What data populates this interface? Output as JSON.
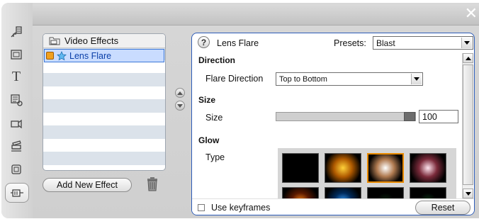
{
  "window": {
    "close_glyph": "✕"
  },
  "toolbar": {
    "items": [
      {
        "name": "project-tool-icon"
      },
      {
        "name": "album-tool-icon"
      },
      {
        "name": "title-tool-icon",
        "glyph": "T"
      },
      {
        "name": "menu-tool-icon"
      },
      {
        "name": "audio-tool-icon"
      },
      {
        "name": "video-capture-tool-icon"
      },
      {
        "name": "transitions-tool-icon"
      },
      {
        "name": "video-effects-tool-icon"
      }
    ]
  },
  "effects_list": {
    "header": "Video Effects",
    "items": [
      {
        "label": "Lens Flare",
        "selected": true
      }
    ],
    "add_button": "Add New Effect"
  },
  "panel": {
    "title": "Lens Flare",
    "presets_label": "Presets:",
    "preset_value": "Blast",
    "sections": {
      "direction": "Direction",
      "size": "Size",
      "glow": "Glow"
    },
    "flare_direction_label": "Flare Direction",
    "flare_direction_value": "Top to Bottom",
    "size_label": "Size",
    "size_value": "100",
    "size_level_percent": 100,
    "glow_type_label": "Type",
    "glow_types": [
      {
        "colors": [
          "#000000",
          "#000000"
        ],
        "selected": false
      },
      {
        "colors": [
          "#ffd23a",
          "#b05a00"
        ],
        "selected": false
      },
      {
        "colors": [
          "#ffffff",
          "#b07a50"
        ],
        "selected": true
      },
      {
        "colors": [
          "#ffe6f0",
          "#7a2a3a"
        ],
        "selected": false
      },
      {
        "colors": [
          "#ff8a1a",
          "#5a1a00"
        ],
        "selected": false
      },
      {
        "colors": [
          "#3aa0ff",
          "#002a5a"
        ],
        "selected": false
      },
      {
        "colors": [
          "#0a2a10",
          "#000000"
        ],
        "selected": false
      },
      {
        "colors": [
          "#0a3a1a",
          "#000000"
        ],
        "selected": false
      }
    ],
    "use_keyframes_label": "Use keyframes",
    "reset_button": "Reset"
  },
  "colors": {
    "accent_border": "#2d5cb8",
    "selected_row_bg": "#c9dcff",
    "selected_glow_border": "#e88a00"
  }
}
